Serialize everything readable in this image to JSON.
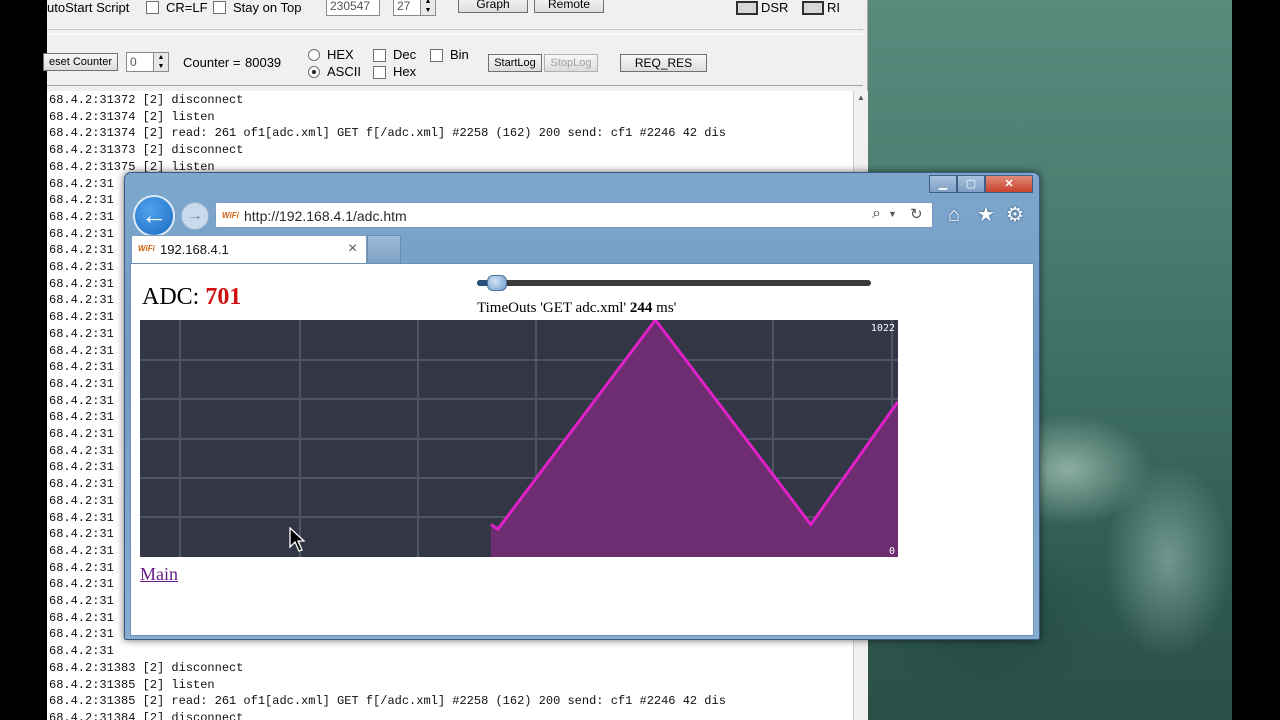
{
  "terminal": {
    "toolbar1": {
      "autostart_label": "utoStart Script",
      "crlf_label": "CR=LF",
      "stay_on_top_label": "Stay on Top",
      "baud_value": "230547",
      "port_value": "27",
      "graph_button": "Graph",
      "remote_button": "Remote",
      "dsr_label": "DSR",
      "ri_label": "RI"
    },
    "toolbar2": {
      "reset_counter_button": "eset Counter",
      "counter_value": "0",
      "counter_label": "Counter =",
      "counter_number": "80039",
      "hex_label": "HEX",
      "ascii_label": "ASCII",
      "dec_label": "Dec",
      "hex2_label": "Hex",
      "bin_label": "Bin",
      "startlog_button": "StartLog",
      "stoplog_button": "StopLog",
      "req_res_button": "REQ_RES"
    },
    "log_lines": [
      "68.4.2:31372 [2] disconnect",
      "68.4.2:31374 [2] listen",
      "68.4.2:31374 [2] read: 261 of1[adc.xml] GET f[/adc.xml] #2258 (162) 200 send: cf1 #2246 42 dis",
      "68.4.2:31373 [2] disconnect",
      "68.4.2:31375 [2] listen",
      "68.4.2:31",
      "68.4.2:31",
      "68.4.2:31",
      "68.4.2:31",
      "68.4.2:31",
      "68.4.2:31",
      "68.4.2:31",
      "68.4.2:31",
      "68.4.2:31",
      "68.4.2:31",
      "68.4.2:31",
      "68.4.2:31",
      "68.4.2:31",
      "68.4.2:31",
      "68.4.2:31",
      "68.4.2:31",
      "68.4.2:31",
      "68.4.2:31",
      "68.4.2:31",
      "68.4.2:31",
      "68.4.2:31",
      "68.4.2:31",
      "68.4.2:31",
      "68.4.2:31",
      "68.4.2:31",
      "68.4.2:31",
      "68.4.2:31",
      "68.4.2:31",
      "68.4.2:31",
      "68.4.2:31383 [2] disconnect",
      "68.4.2:31385 [2] listen",
      "68.4.2:31385 [2] read: 261 of1[adc.xml] GET f[/adc.xml] #2258 (162) 200 send: cf1 #2246 42 dis",
      "68.4.2:31384 [2] disconnect",
      "68.4.2:31386 [2] listen"
    ]
  },
  "browser": {
    "url": "http://192.168.4.1/adc.htm",
    "tab_title": "192.168.4.1",
    "wifi_text": "WiFi",
    "page": {
      "adc_label": "ADC:",
      "adc_value": "701",
      "timeouts_prefix": "TimeOuts 'GET adc.xml'",
      "timeouts_value": "244",
      "timeouts_suffix": "ms'",
      "slider_fraction": 0.05,
      "main_link": "Main"
    }
  },
  "chart_data": {
    "type": "area",
    "y_top_label": "1022",
    "y_bottom_label": "0",
    "ylim": [
      0,
      1022
    ],
    "xlim": [
      0,
      100
    ],
    "grid": true,
    "line_color": "#e020c8",
    "fill_color": "#6e2d70",
    "background": "#333645",
    "x": [
      46.3,
      47.2,
      68.0,
      88.5,
      100
    ],
    "y": [
      140,
      120,
      1022,
      140,
      670
    ]
  }
}
